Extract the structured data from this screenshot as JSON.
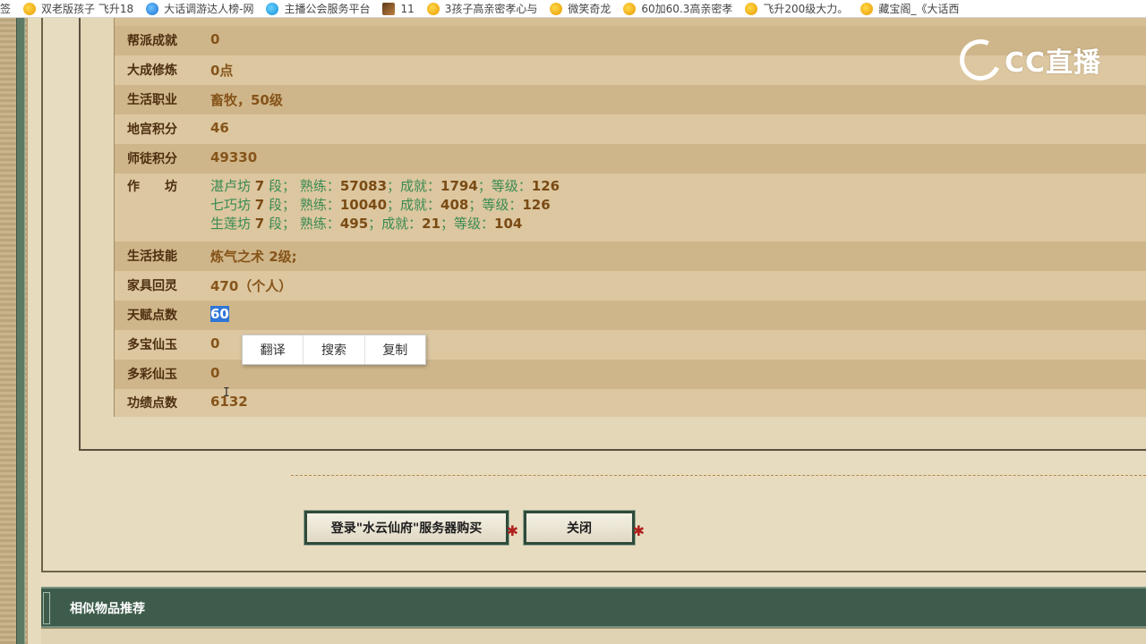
{
  "bookmarks": [
    {
      "icon": "bookmark-icon",
      "label": "签"
    },
    {
      "icon": "chick-icon",
      "label": "双老版孩子 飞升18"
    },
    {
      "icon": "globe-icon",
      "label": "大话调游达人榜-网"
    },
    {
      "icon": "bird-icon",
      "label": "主播公会服务平台"
    },
    {
      "icon": "game-icon",
      "label": "11"
    },
    {
      "icon": "chick-icon",
      "label": "3孩子高亲密孝心与"
    },
    {
      "icon": "chick-icon",
      "label": "微笑奇龙"
    },
    {
      "icon": "chick-icon",
      "label": "60加60.3高亲密孝"
    },
    {
      "icon": "chick-icon",
      "label": "飞升200级大力。"
    },
    {
      "icon": "chick-icon",
      "label": "藏宝阁_《大话西"
    }
  ],
  "rows": [
    {
      "label": "帮派成就",
      "value": "0"
    },
    {
      "label": "大成修炼",
      "value": "0点"
    },
    {
      "label": "生活职业",
      "value": "畜牧，50级"
    },
    {
      "label": "地宫积分",
      "value": "46"
    },
    {
      "label": "师徒积分",
      "value": "49330"
    }
  ],
  "workshop": {
    "label": "作　　坊",
    "lines": [
      {
        "name": "湛卢坊",
        "level": "7",
        "seg": "段；",
        "skill_lbl": "熟练：",
        "skill": "57083",
        "ach_lbl": "；成就：",
        "ach": "1794",
        "lvl_lbl": "；等级：",
        "lvl": "126"
      },
      {
        "name": "七巧坊",
        "level": "7",
        "seg": "段；",
        "skill_lbl": "熟练：",
        "skill": "10040",
        "ach_lbl": "；成就：",
        "ach": "408",
        "lvl_lbl": "；等级：",
        "lvl": "126"
      },
      {
        "name": "生莲坊",
        "level": "7",
        "seg": "段；",
        "skill_lbl": "熟练：",
        "skill": "495",
        "ach_lbl": "；成就：",
        "ach": "21",
        "lvl_lbl": "；等级：",
        "lvl": "104"
      }
    ]
  },
  "rows2": [
    {
      "label": "生活技能",
      "value": "炼气之术 2级;"
    },
    {
      "label": "家具回灵",
      "value": "470（个人）"
    },
    {
      "label": "天赋点数",
      "value": "60"
    },
    {
      "label": "多宝仙玉",
      "value": "0"
    },
    {
      "label": "多彩仙玉",
      "value": "0"
    },
    {
      "label": "功绩点数",
      "value": "6132"
    }
  ],
  "context_menu": {
    "translate": "翻译",
    "search": "搜索",
    "copy": "复制"
  },
  "buttons": {
    "login": "登录\"水云仙府\"服务器购买",
    "close": "关闭"
  },
  "section_title": "相似物品推荐",
  "logo": {
    "text": "CC直播"
  },
  "colors": {
    "accent_green": "#3e5c4c",
    "value_brown": "#86541a",
    "selection_blue": "#2f76d8"
  }
}
